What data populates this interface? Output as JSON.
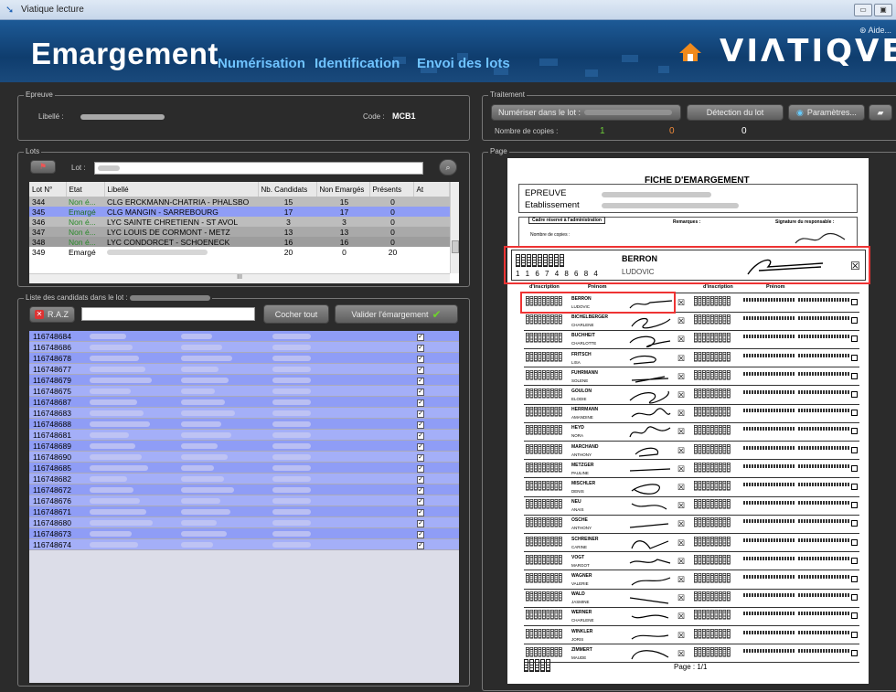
{
  "window": {
    "title": "Viatique lecture"
  },
  "header": {
    "app": "Emargement",
    "nav": [
      "Numérisation",
      "Identification",
      "Envoi des lots"
    ],
    "logo": "VIΛTIQVE",
    "help": "Aide..."
  },
  "epreuve": {
    "legend": "Epreuve",
    "libelle_label": "Libellé :",
    "code_label": "Code :",
    "code": "MCB1"
  },
  "lots": {
    "legend": "Lots",
    "lot_label": "Lot :",
    "columns": [
      "Lot N°",
      "Etat",
      "Libellé",
      "Nb. Candidats",
      "Non Emargés",
      "Présents",
      "At"
    ],
    "rows": [
      [
        "344",
        "Non é...",
        "CLG ERCKMANN-CHATRIA - PHALSBO",
        "15",
        "15",
        "0"
      ],
      [
        "345",
        "Emargé",
        "CLG MANGIN - SARREBOURG",
        "17",
        "17",
        "0"
      ],
      [
        "346",
        "Non é...",
        "LYC SAINTE CHRETIENN - ST AVOL",
        "3",
        "3",
        "0"
      ],
      [
        "347",
        "Non é...",
        "LYC LOUIS DE CORMONT - METZ",
        "13",
        "13",
        "0"
      ],
      [
        "348",
        "Non é...",
        "LYC CONDORCET - SCHOENECK",
        "16",
        "16",
        "0"
      ],
      [
        "349",
        "Emargé",
        "",
        "20",
        "0",
        "20"
      ]
    ],
    "scroll_mark": "III"
  },
  "candidats": {
    "legend": "Liste des candidats dans le lot :",
    "raz": "R.A.Z",
    "cocher": "Cocher tout",
    "valider": "Valider l'émargement",
    "ids": [
      "116748684",
      "116748686",
      "116748678",
      "116748677",
      "116748679",
      "116748675",
      "116748687",
      "116748683",
      "116748688",
      "116748681",
      "116748689",
      "116748690",
      "116748685",
      "116748682",
      "116748672",
      "116748676",
      "116748671",
      "116748680",
      "116748673",
      "116748674"
    ]
  },
  "traitement": {
    "legend": "Traitement",
    "numeriser": "Numériser dans le lot :",
    "detection": "Détection du lot",
    "parametres": "Paramètres...",
    "copies_label": "Nombre de copies :",
    "copies": [
      "1",
      "0",
      "0"
    ]
  },
  "page": {
    "legend": "Page",
    "sheet": {
      "title": "FICHE D'EMARGEMENT",
      "epreuve": "EPREUVE",
      "etab": "Etablissement",
      "cadre": "Cadre réservé à l'administration",
      "remarques": "Remarques :",
      "signature": "Signature du responsable :",
      "nb_copies": "Nombre de copies :",
      "digits": "1 1 6 7 4 8 6 8 4",
      "big_nom": "BERRON",
      "big_prenom": "LUDOVIC",
      "col_insc": "d'inscription",
      "col_prenom": "Prénom",
      "page": "Page : 1/1",
      "students": [
        [
          "BERRON",
          "LUDOVIC"
        ],
        [
          "BICHELBERGER",
          "CHARLENE"
        ],
        [
          "BUCHHEIT",
          "CHARLOTTE"
        ],
        [
          "FRITSCH",
          "LISA"
        ],
        [
          "FUHRMANN",
          "SOLENE"
        ],
        [
          "GOULON",
          "ELODIE"
        ],
        [
          "HERRMANN",
          "AMANDINE"
        ],
        [
          "HEYD",
          "NORA"
        ],
        [
          "MARCHAND",
          "ANTHONY"
        ],
        [
          "METZGER",
          "PAULINE"
        ],
        [
          "MISCHLER",
          "DENIS"
        ],
        [
          "NEU",
          "ANAIS"
        ],
        [
          "OSCHE",
          "ANTHONY"
        ],
        [
          "SCHREINER",
          "CARINE"
        ],
        [
          "VOGT",
          "MARGOT"
        ],
        [
          "WAGNER",
          "VALERIE"
        ],
        [
          "WALD",
          "JASMINE"
        ],
        [
          "WERNER",
          "CHARLENE"
        ],
        [
          "WINKLER",
          "JORIS"
        ],
        [
          "ZIMMERT",
          "MAUDE"
        ]
      ]
    }
  }
}
